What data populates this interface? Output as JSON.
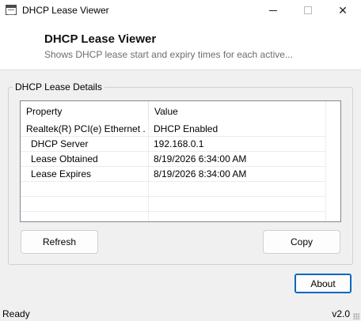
{
  "window": {
    "title": "DHCP Lease Viewer",
    "icons": {
      "app": "window-app-icon",
      "minimize": "minimize-icon",
      "maximize": "maximize-icon",
      "close": "close-icon"
    },
    "close_glyph": "✕"
  },
  "header": {
    "title": "DHCP Lease Viewer",
    "subtitle": "Shows DHCP lease start and expiry times for each active..."
  },
  "group": {
    "label": "DHCP Lease Details"
  },
  "list": {
    "columns": [
      "Property",
      "Value"
    ],
    "rows": [
      {
        "property": "Realtek(R) PCI(e) Ethernet ...",
        "value": "DHCP Enabled"
      },
      {
        "property": "DHCP Server",
        "value": "192.168.0.1"
      },
      {
        "property": "Lease Obtained",
        "value": "8/19/2026 6:34:00 AM"
      },
      {
        "property": "Lease Expires",
        "value": "8/19/2026 8:34:00 AM"
      }
    ]
  },
  "buttons": {
    "refresh": "Refresh",
    "copy": "Copy",
    "about": "About"
  },
  "status": {
    "text": "Ready",
    "version": "v2.0"
  },
  "colors": {
    "accent": "#0067c0",
    "window_bg": "#f0f0f0",
    "header_bg": "#ffffff"
  }
}
